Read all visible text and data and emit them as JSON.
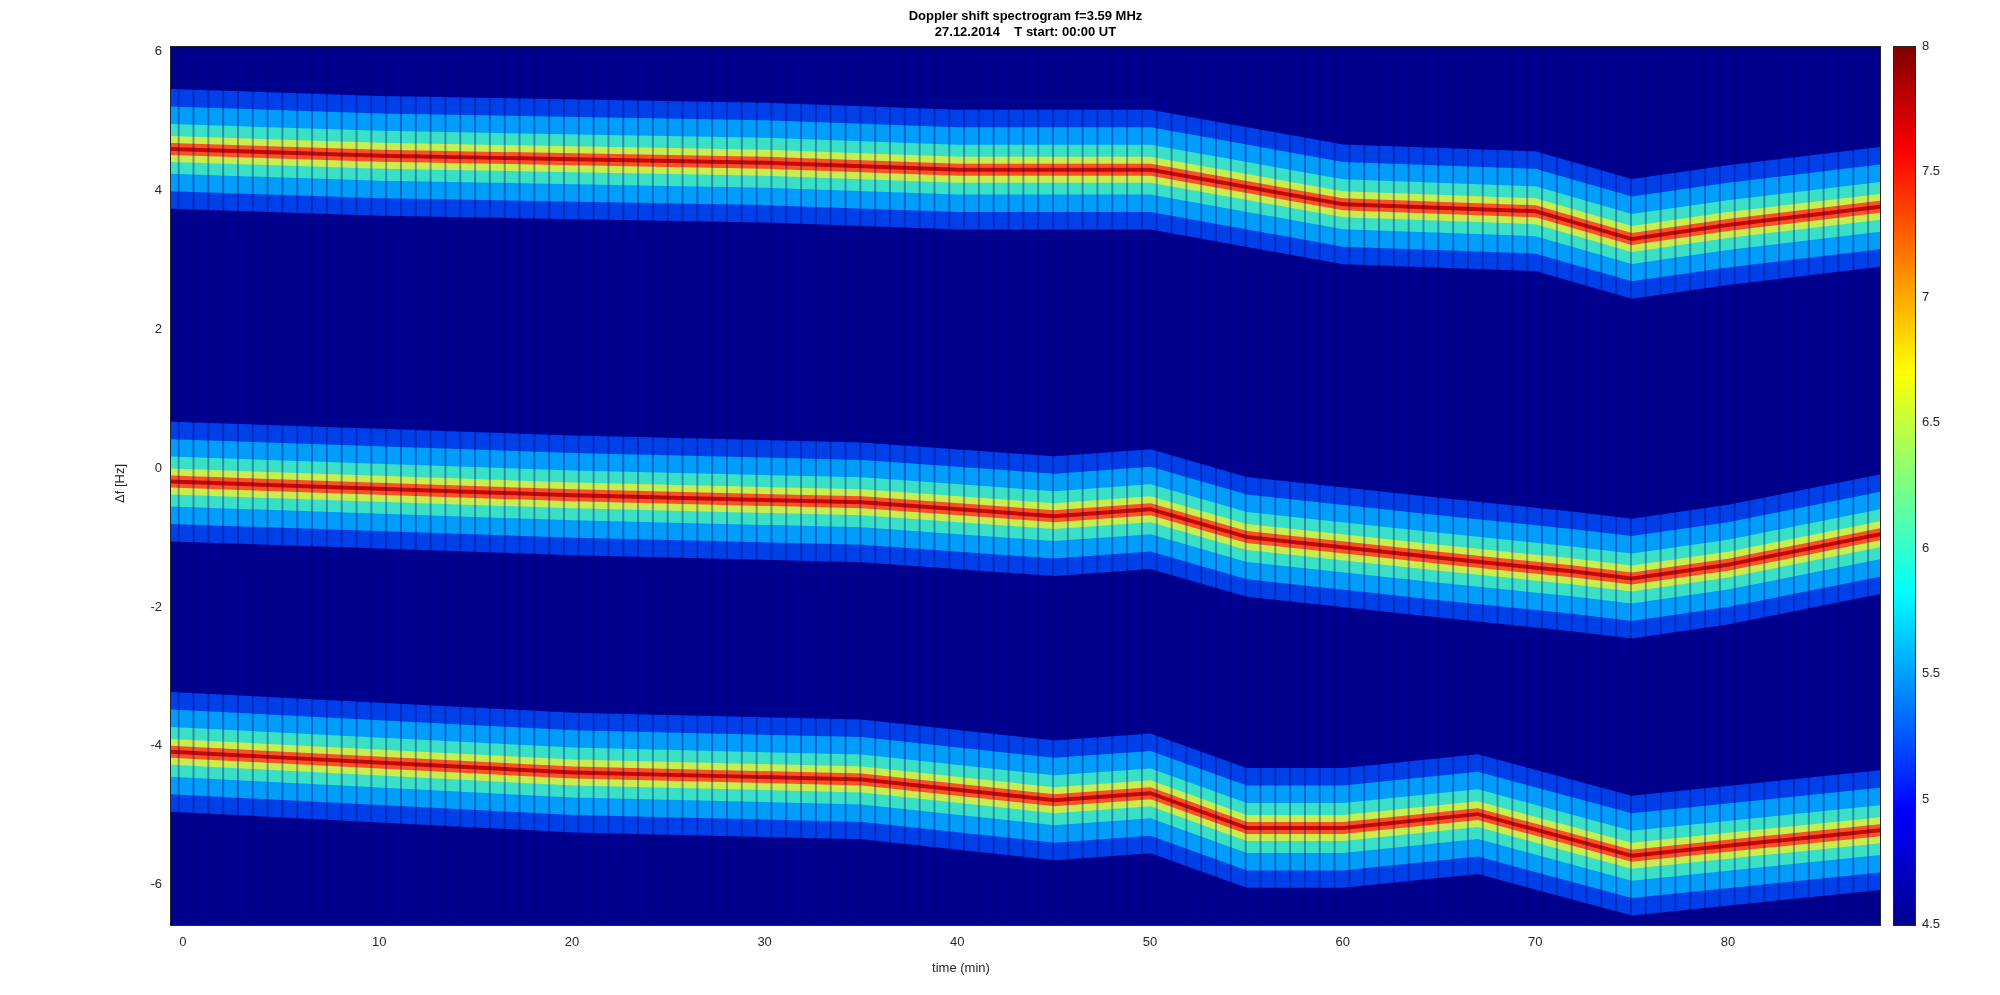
{
  "figure": {
    "title_lines": [
      "Doppler shift spectrogram f=3.59 MHz",
      "27.12.2014    T start: 00:00 UT"
    ],
    "xlabel": "time (min)",
    "ylabel": "Δf [Hz]",
    "xticks": [
      "0",
      "10",
      "20",
      "30",
      "40",
      "50",
      "60",
      "70",
      "80"
    ],
    "yticks": [
      "6",
      "4",
      "2",
      "0",
      "-2",
      "-4",
      "-6"
    ],
    "colorbar_ticks": [
      "8",
      "7.5",
      "7",
      "6.5",
      "6",
      "5.5",
      "5",
      "4.5"
    ]
  }
}
